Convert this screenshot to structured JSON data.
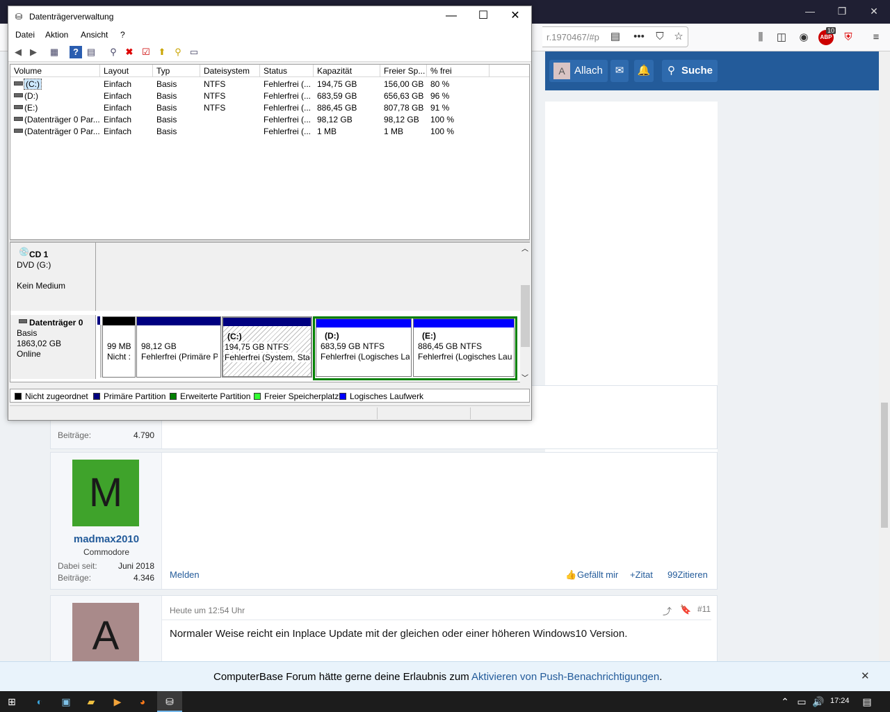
{
  "browser": {
    "url": "r.1970467/#p",
    "badge_count": "10",
    "header": {
      "user": "Allach",
      "user_initial": "A",
      "search": "Suche"
    }
  },
  "forum": {
    "post1_stats": {
      "label": "Beiträge:",
      "value": "4.790"
    },
    "post2": {
      "avatar_letter": "M",
      "avatar_color": "#3fa32b",
      "username": "madmax2010",
      "title": "Commodore",
      "since_label": "Dabei seit:",
      "since_value": "Juni 2018",
      "posts_label": "Beiträge:",
      "posts_value": "4.346",
      "report": "Melden",
      "like": "Gefällt mir",
      "quote": "+Zitat",
      "cite": "99Zitieren"
    },
    "post3": {
      "avatar_letter": "A",
      "avatar_color": "#a98a8a",
      "time": "Heute um 12:54 Uhr",
      "number": "#11",
      "text": "Normaler Weise reicht ein Inplace Update mit der gleichen oder einer höheren Windows10 Version."
    }
  },
  "notification": {
    "text": "ComputerBase Forum hätte gerne deine Erlaubnis zum ",
    "link": "Aktivieren von Push-Benachrichtigungen",
    "end": "."
  },
  "taskbar": {
    "time": "17:24"
  },
  "window": {
    "title": "Datenträgerverwaltung",
    "menu": [
      "Datei",
      "Aktion",
      "Ansicht",
      "?"
    ],
    "columns": [
      "Volume",
      "Layout",
      "Typ",
      "Dateisystem",
      "Status",
      "Kapazität",
      "Freier Sp...",
      "% frei"
    ],
    "rows": [
      [
        "(C:)",
        "Einfach",
        "Basis",
        "NTFS",
        "Fehlerfrei (...",
        "194,75 GB",
        "156,00 GB",
        "80 %"
      ],
      [
        "(D:)",
        "Einfach",
        "Basis",
        "NTFS",
        "Fehlerfrei (...",
        "683,59 GB",
        "656,63 GB",
        "96 %"
      ],
      [
        "(E:)",
        "Einfach",
        "Basis",
        "NTFS",
        "Fehlerfrei (...",
        "886,45 GB",
        "807,78 GB",
        "91 %"
      ],
      [
        "(Datenträger 0 Par...",
        "Einfach",
        "Basis",
        "",
        "Fehlerfrei (...",
        "98,12 GB",
        "98,12 GB",
        "100 %"
      ],
      [
        "(Datenträger 0 Par...",
        "Einfach",
        "Basis",
        "",
        "Fehlerfrei (...",
        "1 MB",
        "1 MB",
        "100 %"
      ]
    ],
    "cd": {
      "name": "CD 1",
      "type": "DVD (G:)",
      "media": "Kein Medium"
    },
    "disk0": {
      "name": "Datenträger 0",
      "type": "Basis",
      "size": "1863,02 GB",
      "state": "Online",
      "partitions": [
        {
          "line1": "",
          "line2": "99 MB",
          "line3": "Nicht :"
        },
        {
          "line1": "",
          "line2": "98,12 GB",
          "line3": "Fehlerfrei (Primäre P"
        },
        {
          "line1": "(C:)",
          "line2": "194,75 GB NTFS",
          "line3": "Fehlerfrei (System, Sta"
        },
        {
          "line1": "(D:)",
          "line2": "683,59 GB NTFS",
          "line3": "Fehlerfrei (Logisches La"
        },
        {
          "line1": "(E:)",
          "line2": "886,45 GB NTFS",
          "line3": "Fehlerfrei (Logisches Lau"
        }
      ]
    },
    "legend": [
      "Nicht zugeordnet",
      "Primäre Partition",
      "Erweiterte Partition",
      "Freier Speicherplatz",
      "Logisches Laufwerk"
    ],
    "legend_colors": [
      "#000000",
      "#000080",
      "#008000",
      "#33ff33",
      "#0000ff"
    ]
  }
}
